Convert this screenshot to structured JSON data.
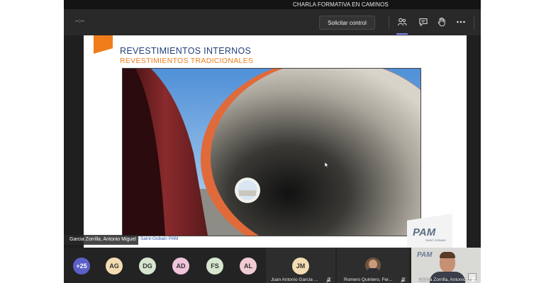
{
  "window": {
    "title": "CHARLA FORMATIVA EN CAMINOS"
  },
  "toolbar": {
    "timer": "--:--",
    "request_control_label": "Solicitar control",
    "icons": [
      "people-icon",
      "chat-icon",
      "raise-hand-icon",
      "more-options-icon"
    ]
  },
  "slide": {
    "heading": "REVESTIMIENTOS  INTERNOS",
    "subheading": "REVESTIMIENTOS TRADICIONALES",
    "footer": "- Saint-Gobain PAM",
    "logo_text": "PAM",
    "logo_subtext": "SAINT-GOBAIN"
  },
  "presenter": {
    "name": "Garcia Zorrilla, Antonio Miguel"
  },
  "participants": {
    "overflow": "+25",
    "avatars": [
      {
        "initials": "AG",
        "color": "#f3dcb2"
      },
      {
        "initials": "DG",
        "color": "#d6e6cf"
      },
      {
        "initials": "AD",
        "color": "#f0c4dc"
      },
      {
        "initials": "FS",
        "color": "#d7e7cf"
      },
      {
        "initials": "AL",
        "color": "#f1cbd3"
      }
    ],
    "tiles": [
      {
        "initials": "JM",
        "name": "Juan Antonio García ...",
        "color": "#f3dcb2"
      },
      {
        "name": "Romero Quintero, Fer..."
      },
      {
        "name": "García Zorrilla, Antonio"
      }
    ],
    "camera_logo": "PAM"
  },
  "colors": {
    "slide_heading": "#24407a",
    "slide_accent": "#f07d1a",
    "toolbar_bg": "#292929",
    "overflow_avatar": "#5b5fc7"
  }
}
